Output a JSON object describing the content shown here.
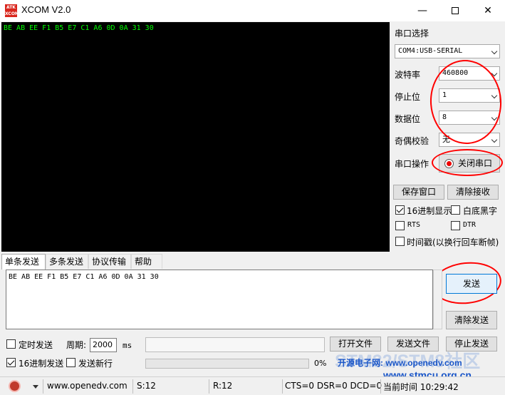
{
  "window": {
    "title": "XCOM V2.0",
    "icon_text": [
      "ATK",
      "XCOM"
    ],
    "minimize_glyph": "—",
    "close_glyph": "✕"
  },
  "receive": {
    "text": "BE AB EE F1 B5 E7 C1 A6 0D 0A 31 30"
  },
  "serial": {
    "port_label": "串口选择",
    "port_value": "COM4:USB-SERIAL",
    "baud_label": "波特率",
    "baud_value": "460800",
    "stop_label": "停止位",
    "stop_value": "1",
    "data_label": "数据位",
    "data_value": "8",
    "parity_label": "奇偶校验",
    "parity_value": "无",
    "op_label": "串口操作",
    "op_button": "关闭串口"
  },
  "recv_options": {
    "save_window": "保存窗口",
    "clear_receive": "清除接收",
    "hex_display": "16进制显示",
    "white_bg": "白底黑字",
    "rts": "RTS",
    "dtr": "DTR",
    "timestamp": "时间戳(以换行回车断帧)"
  },
  "tabs": [
    "单条发送",
    "多条发送",
    "协议传输",
    "帮助"
  ],
  "send": {
    "text": "BE AB EE F1 B5 E7 C1 A6 0D 0A 31 30",
    "send_button": "发送",
    "clear_send": "清除发送",
    "timed_send": "定时发送",
    "period_label": "周期:",
    "period_value": "2000",
    "period_unit": "ms",
    "open_file": "打开文件",
    "send_file": "发送文件",
    "stop_send": "停止发送",
    "hex_send": "16进制发送",
    "send_newline": "发送新行",
    "progress_text": "0%"
  },
  "status": {
    "website": "www.openedv.com",
    "sent": "S:12",
    "received": "R:12",
    "signals": "CTS=0 DSR=0 DCD=0",
    "time": "当前时间 10:29:42"
  },
  "watermark": {
    "line1": "开源电子网: www.openedv.com",
    "line2": "www.stmcu.org.cn",
    "big": "STM32/STM8社区"
  },
  "colors": {
    "receive_bg": "#000000",
    "receive_text": "#00ff00",
    "annotation": "#ff0000",
    "watermark": "#1a56c8"
  }
}
